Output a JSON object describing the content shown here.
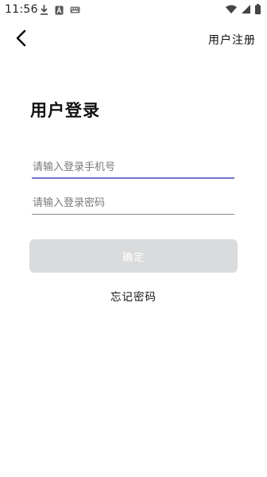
{
  "status_bar": {
    "time": "11:56",
    "icons_left": [
      "download-icon",
      "text-a-icon",
      "keyboard-icon"
    ],
    "icons_right": [
      "wifi-icon",
      "cell-signal-icon",
      "battery-icon"
    ]
  },
  "header": {
    "back_icon": "chevron-left-icon",
    "register_label": "用户注册"
  },
  "login": {
    "title": "用户登录",
    "phone_placeholder": "请输入登录手机号",
    "password_placeholder": "请输入登录密码",
    "confirm_label": "确定",
    "forgot_label": "忘记密码"
  },
  "colors": {
    "active_underline": "#6b78c9",
    "button_disabled_bg": "#dadbdd"
  }
}
